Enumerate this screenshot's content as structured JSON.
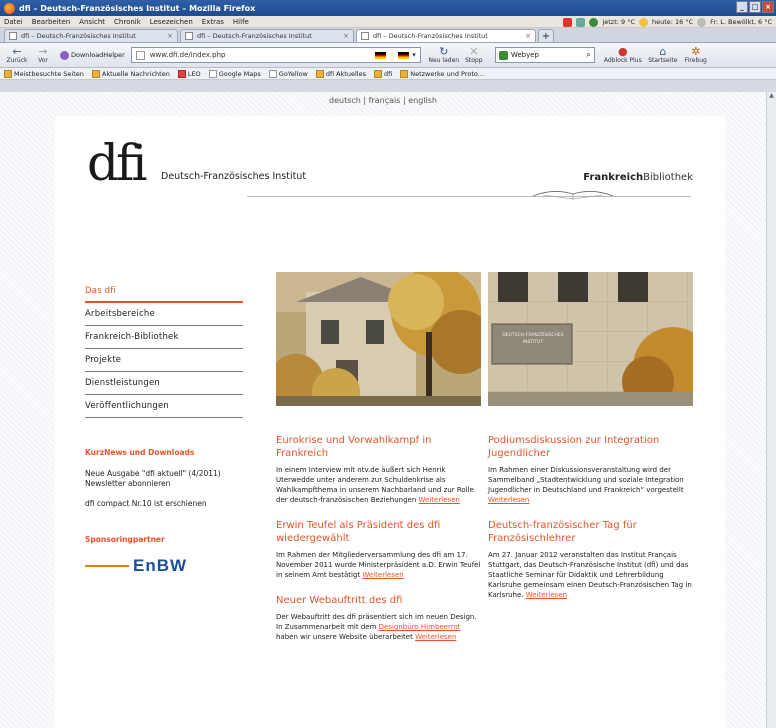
{
  "window": {
    "title": "dfi – Deutsch-Französisches Institut – Mozilla Firefox"
  },
  "menu": [
    "Datei",
    "Bearbeiten",
    "Ansicht",
    "Chronik",
    "Lesezeichen",
    "Extras",
    "Hilfe"
  ],
  "status": {
    "now": "jetzt: 9 °C",
    "today": "heute: 16 °C",
    "fri": "Fr: L. Bewölkt, 6 °C"
  },
  "tabs": [
    {
      "label": "dfi – Deutsch-Französisches Institut"
    },
    {
      "label": "dfi – Deutsch-Französisches Institut"
    },
    {
      "label": "dfi – Deutsch-Französisches Institut"
    }
  ],
  "nav": {
    "back": "Zurück",
    "forward": "Vor",
    "downloadhelper": "DownloadHelper",
    "url": "www.dfi.de/index.php",
    "reload": "Neu laden",
    "stop": "Stopp",
    "search_placeholder": "Webyep",
    "adblock": "Adblock Plus",
    "home": "Startseite",
    "firebug": "Firebug"
  },
  "bookmarks": [
    "Meistbesuchte Seiten",
    "Aktuelle Nachrichten",
    "LEO",
    "Google Maps",
    "GoYellow",
    "dfi Aktuelles",
    "dfi",
    "Netzwerke und Proto..."
  ],
  "languages": "deutsch | français | english",
  "logo": {
    "mark": "dfi",
    "name": "Deutsch-Französisches Institut",
    "bibliothek_bold": "Frankreich",
    "bibliothek": "Bibliothek"
  },
  "sidebar": {
    "items": [
      "Das dfi",
      "Arbeitsbereiche",
      "Frankreich-Bibliothek",
      "Projekte",
      "Dienstleistungen",
      "Veröffentlichungen"
    ],
    "news_heading": "KurzNews und Downloads",
    "news": [
      "Neue Ausgabe \"dfi aktuell\" (4/2011) Newsletter abonnieren",
      "dfi compact Nr.10 ist erschienen"
    ],
    "sponsor_heading": "Sponsoringpartner",
    "sponsor": "EnBW"
  },
  "articles_left": [
    {
      "title": "Eurokrise und Vorwahlkampf in Frankreich",
      "text": "In einem Interview mit ntv.de äußert sich Henrik Uterwedde unter anderem zur Schuldenkrise als Wahlkampfthema in unserem Nachbarland und zur Rolle der deutsch-französischen Beziehungen ",
      "more": "Weiterlesen"
    },
    {
      "title": "Erwin Teufel als Präsident des dfi wiedergewählt",
      "text": "Im Rahmen der Mitgliederversammlung des dfi am 17. November 2011 wurde Ministerpräsident a.D. Erwin Teufel in seinem Amt bestätigt ",
      "more": "Weiterlesen"
    },
    {
      "title": "Neuer Webauftritt des dfi",
      "text_a": "Der Webauftritt des dfi präsentiert sich im neuen Design. In Zusammenarbeit mit dem ",
      "link": "Designbüro Himbeerrot",
      "text_b": " haben wir unsere Website überarbeitet ",
      "more": "Weiterlesen"
    }
  ],
  "articles_right": [
    {
      "title": "Podiumsdiskussion zur Integration Jugendlicher",
      "text": "Im Rahmen einer Diskussionsveranstaltung wird der Sammelband „Stadtentwicklung und soziale Integration Jugendlicher in Deutschland und Frankreich“ vorgestellt ",
      "more": "Weiterlesen"
    },
    {
      "title": "Deutsch-französischer Tag für Französischlehrer",
      "text": "Am 27. Januar 2012 veranstalten das Institut Français Stuttgart, das Deutsch-Französische Institut (dfi) und das Staatliche Seminar für Didaktik und Lehrerbildung Karlsruhe gemeinsam einen Deutsch-Französischen Tag in Karlsruhe. ",
      "more": "Weiterlesen"
    }
  ],
  "photo_sign": "DEUTSCH-FRANZÖSISCHES INSTITUT"
}
